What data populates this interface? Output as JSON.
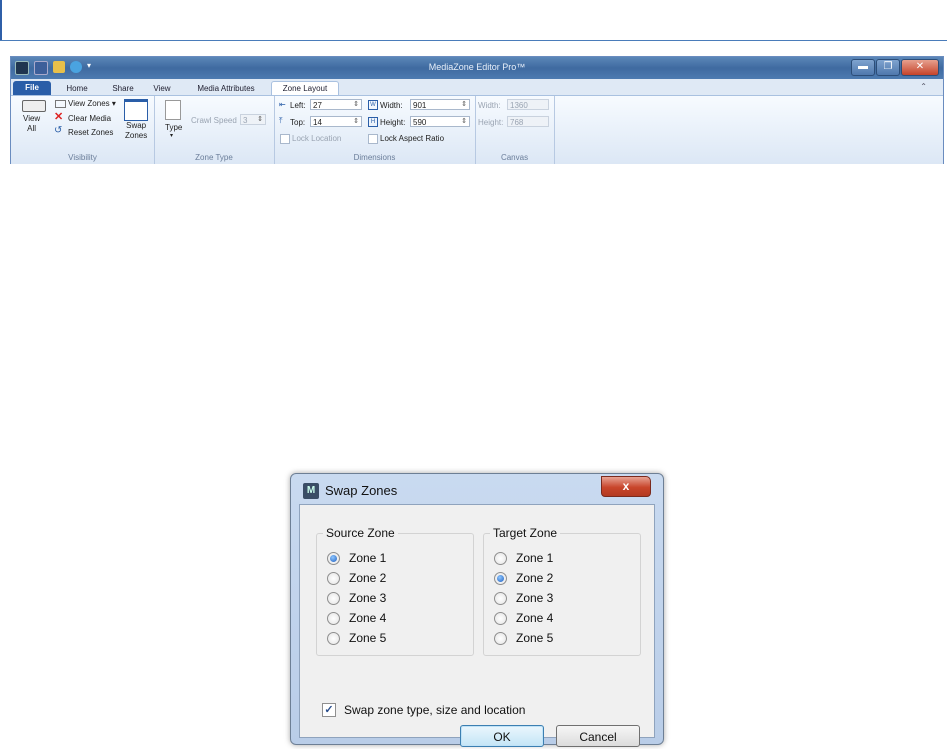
{
  "window": {
    "title": "MediaZone Editor Pro™",
    "tabs": [
      "File",
      "Home",
      "Share",
      "View",
      "Media Attributes",
      "Zone Layout"
    ],
    "active_tab": "Zone Layout"
  },
  "ribbon": {
    "visibility": {
      "view_all": "View\nAll",
      "view_zones": "View Zones ▾",
      "clear_media": "Clear Media",
      "reset_zones": "Reset Zones",
      "swap_zones": "Swap\nZones",
      "label": "Visibility"
    },
    "zone_type": {
      "type_label": "Type",
      "crawl_speed_label": "Crawl Speed",
      "crawl_speed_value": "3",
      "label": "Zone Type"
    },
    "dimensions": {
      "left_label": "Left:",
      "left_value": "27",
      "top_label": "Top:",
      "top_value": "14",
      "width_label": "Width:",
      "width_value": "901",
      "height_label": "Height:",
      "height_value": "590",
      "lock_location": "Lock Location",
      "lock_aspect": "Lock Aspect Ratio",
      "label": "Dimensions"
    },
    "canvas": {
      "width_label": "Width:",
      "width_value": "1360",
      "height_label": "Height:",
      "height_value": "768",
      "label": "Canvas"
    }
  },
  "dialog": {
    "title": "Swap Zones",
    "close": "x",
    "source": {
      "legend": "Source Zone",
      "options": [
        "Zone 1",
        "Zone 2",
        "Zone 3",
        "Zone 4",
        "Zone 5"
      ],
      "selected": 0
    },
    "target": {
      "legend": "Target Zone",
      "options": [
        "Zone 1",
        "Zone 2",
        "Zone 3",
        "Zone 4",
        "Zone 5"
      ],
      "selected": 1
    },
    "swap_option": {
      "label": "Swap zone type, size and location",
      "checked": true
    },
    "ok": "OK",
    "cancel": "Cancel"
  }
}
